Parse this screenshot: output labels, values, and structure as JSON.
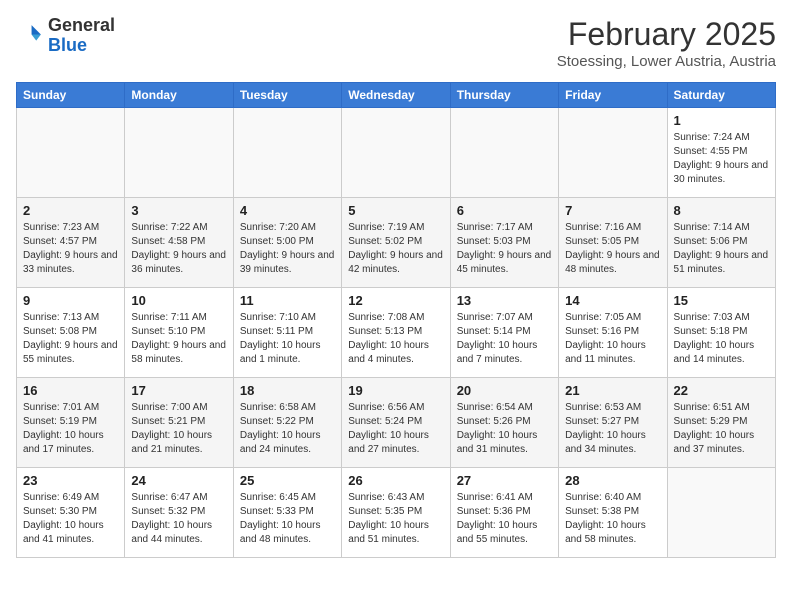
{
  "header": {
    "logo_general": "General",
    "logo_blue": "Blue",
    "month": "February 2025",
    "location": "Stoessing, Lower Austria, Austria"
  },
  "weekdays": [
    "Sunday",
    "Monday",
    "Tuesday",
    "Wednesday",
    "Thursday",
    "Friday",
    "Saturday"
  ],
  "weeks": [
    [
      {
        "day": "",
        "info": ""
      },
      {
        "day": "",
        "info": ""
      },
      {
        "day": "",
        "info": ""
      },
      {
        "day": "",
        "info": ""
      },
      {
        "day": "",
        "info": ""
      },
      {
        "day": "",
        "info": ""
      },
      {
        "day": "1",
        "info": "Sunrise: 7:24 AM\nSunset: 4:55 PM\nDaylight: 9 hours and 30 minutes."
      }
    ],
    [
      {
        "day": "2",
        "info": "Sunrise: 7:23 AM\nSunset: 4:57 PM\nDaylight: 9 hours and 33 minutes."
      },
      {
        "day": "3",
        "info": "Sunrise: 7:22 AM\nSunset: 4:58 PM\nDaylight: 9 hours and 36 minutes."
      },
      {
        "day": "4",
        "info": "Sunrise: 7:20 AM\nSunset: 5:00 PM\nDaylight: 9 hours and 39 minutes."
      },
      {
        "day": "5",
        "info": "Sunrise: 7:19 AM\nSunset: 5:02 PM\nDaylight: 9 hours and 42 minutes."
      },
      {
        "day": "6",
        "info": "Sunrise: 7:17 AM\nSunset: 5:03 PM\nDaylight: 9 hours and 45 minutes."
      },
      {
        "day": "7",
        "info": "Sunrise: 7:16 AM\nSunset: 5:05 PM\nDaylight: 9 hours and 48 minutes."
      },
      {
        "day": "8",
        "info": "Sunrise: 7:14 AM\nSunset: 5:06 PM\nDaylight: 9 hours and 51 minutes."
      }
    ],
    [
      {
        "day": "9",
        "info": "Sunrise: 7:13 AM\nSunset: 5:08 PM\nDaylight: 9 hours and 55 minutes."
      },
      {
        "day": "10",
        "info": "Sunrise: 7:11 AM\nSunset: 5:10 PM\nDaylight: 9 hours and 58 minutes."
      },
      {
        "day": "11",
        "info": "Sunrise: 7:10 AM\nSunset: 5:11 PM\nDaylight: 10 hours and 1 minute."
      },
      {
        "day": "12",
        "info": "Sunrise: 7:08 AM\nSunset: 5:13 PM\nDaylight: 10 hours and 4 minutes."
      },
      {
        "day": "13",
        "info": "Sunrise: 7:07 AM\nSunset: 5:14 PM\nDaylight: 10 hours and 7 minutes."
      },
      {
        "day": "14",
        "info": "Sunrise: 7:05 AM\nSunset: 5:16 PM\nDaylight: 10 hours and 11 minutes."
      },
      {
        "day": "15",
        "info": "Sunrise: 7:03 AM\nSunset: 5:18 PM\nDaylight: 10 hours and 14 minutes."
      }
    ],
    [
      {
        "day": "16",
        "info": "Sunrise: 7:01 AM\nSunset: 5:19 PM\nDaylight: 10 hours and 17 minutes."
      },
      {
        "day": "17",
        "info": "Sunrise: 7:00 AM\nSunset: 5:21 PM\nDaylight: 10 hours and 21 minutes."
      },
      {
        "day": "18",
        "info": "Sunrise: 6:58 AM\nSunset: 5:22 PM\nDaylight: 10 hours and 24 minutes."
      },
      {
        "day": "19",
        "info": "Sunrise: 6:56 AM\nSunset: 5:24 PM\nDaylight: 10 hours and 27 minutes."
      },
      {
        "day": "20",
        "info": "Sunrise: 6:54 AM\nSunset: 5:26 PM\nDaylight: 10 hours and 31 minutes."
      },
      {
        "day": "21",
        "info": "Sunrise: 6:53 AM\nSunset: 5:27 PM\nDaylight: 10 hours and 34 minutes."
      },
      {
        "day": "22",
        "info": "Sunrise: 6:51 AM\nSunset: 5:29 PM\nDaylight: 10 hours and 37 minutes."
      }
    ],
    [
      {
        "day": "23",
        "info": "Sunrise: 6:49 AM\nSunset: 5:30 PM\nDaylight: 10 hours and 41 minutes."
      },
      {
        "day": "24",
        "info": "Sunrise: 6:47 AM\nSunset: 5:32 PM\nDaylight: 10 hours and 44 minutes."
      },
      {
        "day": "25",
        "info": "Sunrise: 6:45 AM\nSunset: 5:33 PM\nDaylight: 10 hours and 48 minutes."
      },
      {
        "day": "26",
        "info": "Sunrise: 6:43 AM\nSunset: 5:35 PM\nDaylight: 10 hours and 51 minutes."
      },
      {
        "day": "27",
        "info": "Sunrise: 6:41 AM\nSunset: 5:36 PM\nDaylight: 10 hours and 55 minutes."
      },
      {
        "day": "28",
        "info": "Sunrise: 6:40 AM\nSunset: 5:38 PM\nDaylight: 10 hours and 58 minutes."
      },
      {
        "day": "",
        "info": ""
      }
    ]
  ]
}
